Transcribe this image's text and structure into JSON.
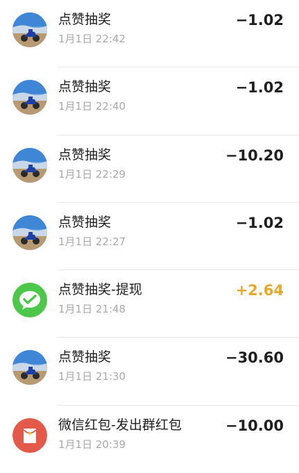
{
  "transactions": [
    {
      "title": "点赞抽奖",
      "time": "1月1日 22:42",
      "amount": "−1.02",
      "icon": "user-avatar-motorcycle",
      "type": "expense"
    },
    {
      "title": "点赞抽奖",
      "time": "1月1日 22:40",
      "amount": "−1.02",
      "icon": "user-avatar-motorcycle",
      "type": "expense"
    },
    {
      "title": "点赞抽奖",
      "time": "1月1日 22:29",
      "amount": "−10.20",
      "icon": "user-avatar-motorcycle",
      "type": "expense"
    },
    {
      "title": "点赞抽奖",
      "time": "1月1日 22:27",
      "amount": "−1.02",
      "icon": "user-avatar-motorcycle",
      "type": "expense"
    },
    {
      "title": "点赞抽奖-提现",
      "time": "1月1日 21:48",
      "amount": "+2.64",
      "icon": "wechat-pay-icon",
      "type": "income"
    },
    {
      "title": "点赞抽奖",
      "time": "1月1日 21:30",
      "amount": "−30.60",
      "icon": "user-avatar-motorcycle",
      "type": "expense"
    },
    {
      "title": "微信红包-发出群红包",
      "time": "1月1日 20:39",
      "amount": "−10.00",
      "icon": "red-packet-icon",
      "type": "expense"
    }
  ],
  "colors": {
    "income": "#e8a82a",
    "expense": "#1f1f1f",
    "wechat_green": "#4cc74a",
    "red_packet": "#e45a4a"
  }
}
